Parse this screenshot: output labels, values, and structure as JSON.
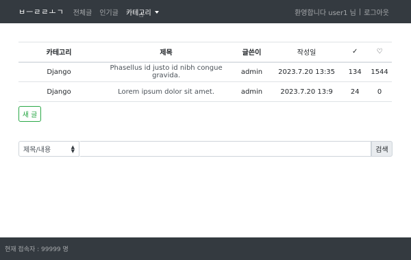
{
  "navbar": {
    "brand": "ㅂㅡㄹㄹㅗㄱ",
    "links": [
      "전체글",
      "인기글",
      "카테고리"
    ],
    "welcome": "환영합니다 user1 님",
    "separator": "|",
    "logout": "로그아웃"
  },
  "table": {
    "headers": {
      "category": "카테고리",
      "title": "제목",
      "author": "글쓴이",
      "date": "작성일",
      "views_icon": "check-icon",
      "likes_icon": "heart-icon"
    },
    "rows": [
      {
        "category": "Django",
        "title": "Phasellus id justo id nibh congue gravida.",
        "author": "admin",
        "date": "2023.7.20 13:35",
        "views": "134",
        "likes": "1544"
      },
      {
        "category": "Django",
        "title": "Lorem ipsum dolor sit amet.",
        "author": "admin",
        "date": "2023.7.20 13:9",
        "views": "24",
        "likes": "0"
      }
    ]
  },
  "new_post_button": "새 글",
  "search": {
    "select_value": "제목/내용",
    "input_value": "",
    "button": "검색"
  },
  "footer": {
    "text": "현재 접속자 : 99999 명"
  },
  "colors": {
    "navbar_bg": "#343a40",
    "success": "#28a745"
  }
}
